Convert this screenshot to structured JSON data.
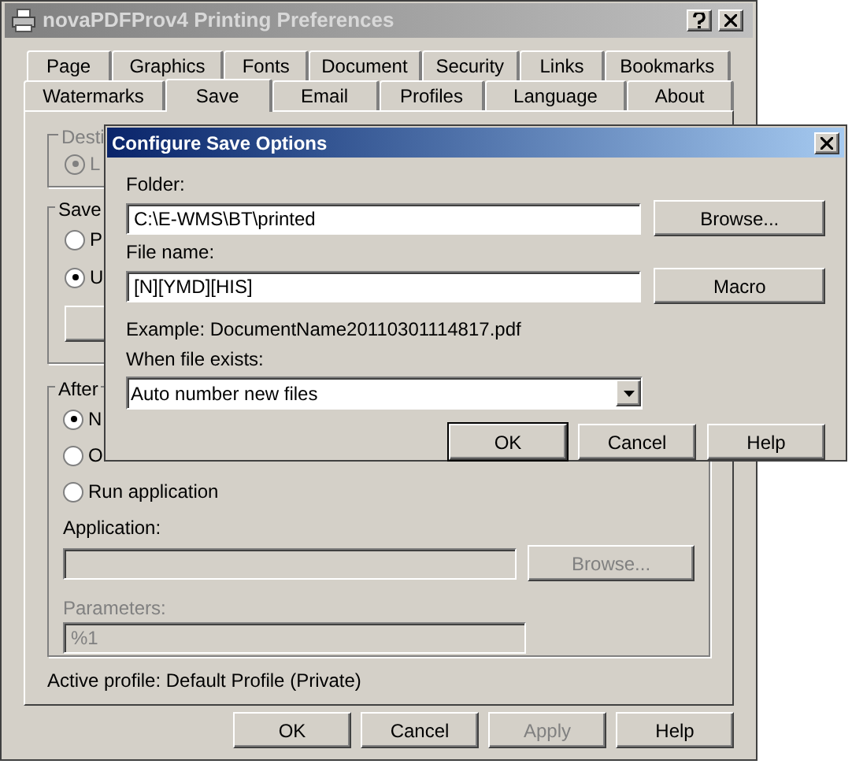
{
  "main_window": {
    "title": "novaPDFProv4 Printing Preferences",
    "tab_rows": [
      [
        {
          "label": "Page",
          "selected": false
        },
        {
          "label": "Graphics",
          "selected": false
        },
        {
          "label": "Fonts",
          "selected": false
        },
        {
          "label": "Document",
          "selected": false
        },
        {
          "label": "Security",
          "selected": false
        },
        {
          "label": "Links",
          "selected": false
        },
        {
          "label": "Bookmarks",
          "selected": false
        }
      ],
      [
        {
          "label": "Watermarks",
          "selected": false
        },
        {
          "label": "Save",
          "selected": true
        },
        {
          "label": "Email",
          "selected": false
        },
        {
          "label": "Profiles",
          "selected": false
        },
        {
          "label": "Language",
          "selected": false
        },
        {
          "label": "About",
          "selected": false
        }
      ]
    ],
    "destination_group": {
      "label": "Desti",
      "options": [
        {
          "label": "L",
          "selected": true,
          "disabled": true
        }
      ]
    },
    "save_group": {
      "label": "Save",
      "options": [
        {
          "label": "P",
          "selected": false,
          "disabled": false
        },
        {
          "label": "U",
          "selected": true,
          "disabled": false
        }
      ]
    },
    "after_group": {
      "label": "After",
      "options": [
        {
          "label": "N",
          "selected": true,
          "disabled": false
        },
        {
          "label": "O",
          "selected": false,
          "disabled": false
        },
        {
          "label": "Run application",
          "selected": false,
          "disabled": false
        }
      ],
      "application": {
        "label": "Application:"
      },
      "browse_button": {
        "label": "Browse...",
        "disabled": true
      },
      "parameters": {
        "label": "Parameters:",
        "value": "%1",
        "disabled": true
      }
    },
    "active_profile": "Active profile: Default Profile (Private)",
    "buttons": [
      {
        "label": "OK",
        "disabled": false
      },
      {
        "label": "Cancel",
        "disabled": false
      },
      {
        "label": "Apply",
        "disabled": true
      },
      {
        "label": "Help",
        "disabled": false
      }
    ]
  },
  "dialog": {
    "title": "Configure Save Options",
    "folder": {
      "label": "Folder:",
      "value": "C:\\E-WMS\\BT\\printed"
    },
    "folder_button": "Browse...",
    "file_name": {
      "label": "File name:",
      "value": "[N][YMD][HIS]"
    },
    "macro_button": "Macro",
    "example": "Example: DocumentName20110301114817.pdf",
    "when_exists": {
      "label": "When file exists:",
      "value": "Auto number new files"
    },
    "buttons": [
      {
        "label": "OK",
        "default": true
      },
      {
        "label": "Cancel",
        "default": false
      },
      {
        "label": "Help",
        "default": false
      }
    ]
  }
}
